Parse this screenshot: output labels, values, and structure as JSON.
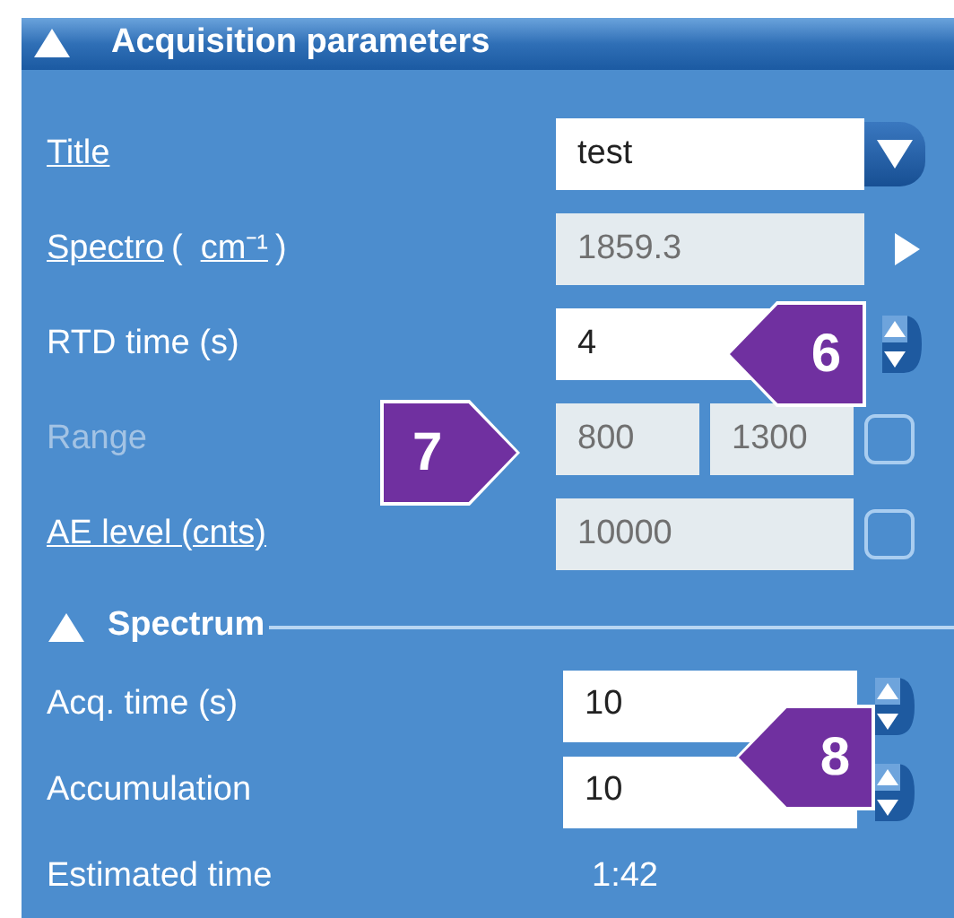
{
  "panel": {
    "title": "Acquisition parameters",
    "expanded": true
  },
  "rows": [
    {
      "kind": "dropdown",
      "label": "Title",
      "link": true,
      "disabled": false,
      "value": "test",
      "field_disabled": false
    },
    {
      "kind": "arrow",
      "label": "Spectro",
      "link": true,
      "disabled": false,
      "unit_open": "(",
      "unit": "cm⁻¹",
      "unit_close": ")",
      "value": "1859.3",
      "field_disabled": true
    },
    {
      "kind": "spinner",
      "label": "RTD time (s)",
      "link": false,
      "disabled": false,
      "value": "4",
      "field_disabled": false
    },
    {
      "kind": "range",
      "label": "Range",
      "link": false,
      "disabled": true,
      "values": [
        "800",
        "1300"
      ],
      "field_disabled": true,
      "checked": false
    },
    {
      "kind": "check",
      "label": "AE level (cnts)",
      "link": true,
      "disabled": false,
      "value": "10000",
      "field_disabled": true,
      "checked": false
    }
  ],
  "spectrum": {
    "title": "Spectrum",
    "expanded": true,
    "rows": [
      {
        "kind": "spinner",
        "label": "Acq. time (s)",
        "value": "10"
      },
      {
        "kind": "spinner",
        "label": "Accumulation",
        "value": "10"
      },
      {
        "kind": "readout",
        "label": "Estimated time",
        "value": "1:42"
      }
    ]
  },
  "callouts": [
    {
      "label": "6",
      "kind": "pointer_left"
    },
    {
      "label": "7",
      "kind": "pointer_right"
    },
    {
      "label": "8",
      "kind": "pointer_left"
    }
  ]
}
